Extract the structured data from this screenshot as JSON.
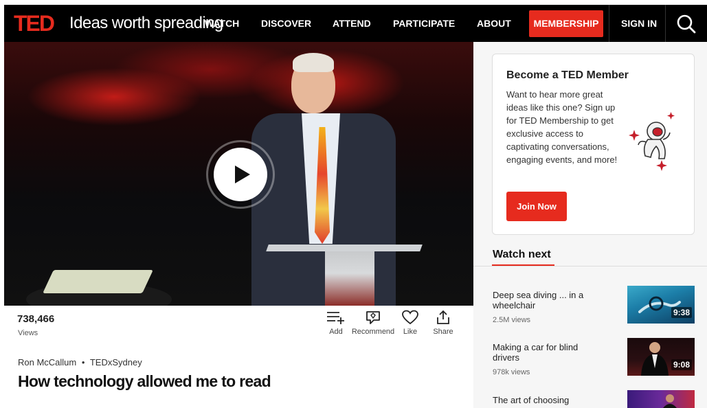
{
  "nav": {
    "logo": "TED",
    "tagline": "Ideas worth spreading",
    "links": [
      "WATCH",
      "DISCOVER",
      "ATTEND",
      "PARTICIPATE",
      "ABOUT"
    ],
    "membership": "MEMBERSHIP",
    "signin": "SIGN IN"
  },
  "talk": {
    "views": "738,466",
    "views_label": "Views",
    "actions": [
      "Add",
      "Recommend",
      "Like",
      "Share"
    ],
    "speaker": "Ron McCallum",
    "event": "TEDxSydney",
    "separator": "•",
    "title": "How technology allowed me to read"
  },
  "member_card": {
    "title": "Become a TED Member",
    "body": "Want to hear more great ideas like this one? Sign up for TED Membership to get exclusive access to captivating conversations, engaging events, and more!",
    "button": "Join Now"
  },
  "watch_next": {
    "heading": "Watch next",
    "items": [
      {
        "title": "Deep sea diving ... in a wheelchair",
        "views": "2.5M views",
        "duration": "9:38"
      },
      {
        "title": "Making a car for blind drivers",
        "views": "978k views",
        "duration": "9:08"
      },
      {
        "title": "The art of choosing",
        "views": "",
        "duration": ""
      }
    ]
  },
  "colors": {
    "brand_red": "#e62b1e",
    "nav_bg": "#000000",
    "sidebar_bg": "#f6f6f6"
  }
}
